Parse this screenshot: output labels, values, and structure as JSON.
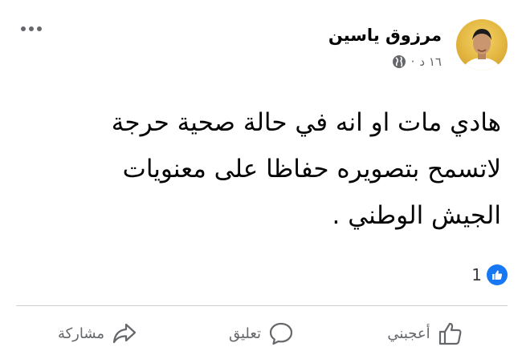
{
  "post": {
    "author": "مرزوق ياسين",
    "time": "١٦ د",
    "separator": "·",
    "privacy_icon": "globe-icon",
    "body": "هادي مات او انه في حالة صحية حرجة\nلاتسمح بتصويره حفاظا على معنويات\nالجيش الوطني .",
    "reaction_icon": "like-icon",
    "reaction_count": "1"
  },
  "actions": {
    "like_label": "أعجبني",
    "comment_label": "تعليق",
    "share_label": "مشاركة"
  },
  "colors": {
    "accent": "#1877f2",
    "secondary_text": "#65676b",
    "divider": "#ced0d4"
  }
}
